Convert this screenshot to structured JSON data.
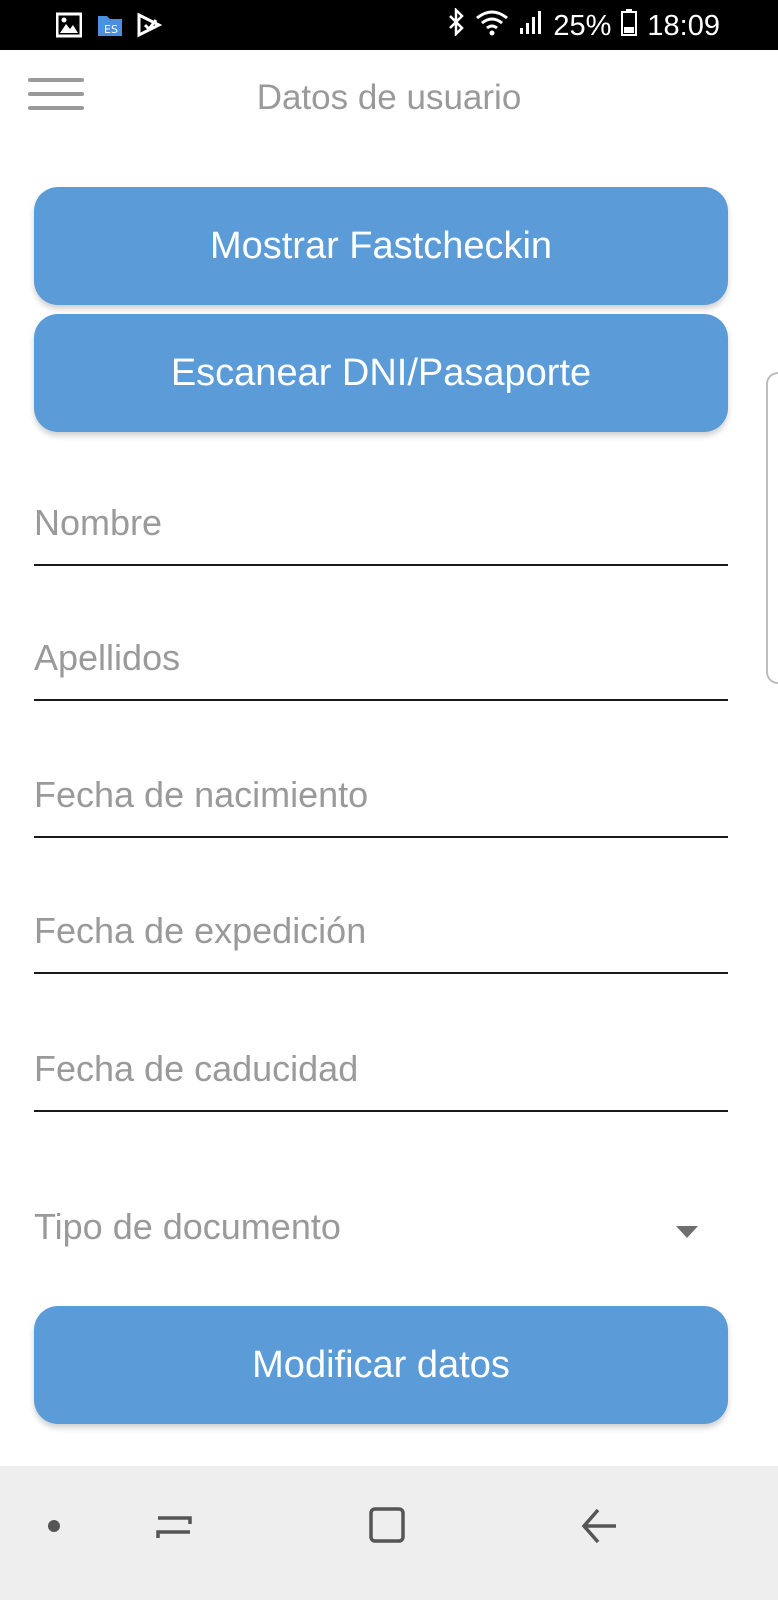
{
  "status_bar": {
    "battery": "25%",
    "time": "18:09",
    "icons": [
      "gallery-icon",
      "file-manager-icon",
      "play-store-icon",
      "bluetooth-icon",
      "wifi-icon",
      "signal-icon",
      "battery-icon"
    ]
  },
  "app_bar": {
    "title": "Datos de usuario",
    "menu_icon": "hamburger-menu-icon"
  },
  "buttons": {
    "show_fastcheckin": "Mostrar Fastcheckin",
    "scan_document": "Escanear DNI/Pasaporte",
    "modify_data": "Modificar datos"
  },
  "form": {
    "fields": [
      {
        "label": "Nombre",
        "value": ""
      },
      {
        "label": "Apellidos",
        "value": ""
      },
      {
        "label": "Fecha de nacimiento",
        "value": ""
      },
      {
        "label": "Fecha de expedición",
        "value": ""
      },
      {
        "label": "Fecha de caducidad",
        "value": ""
      }
    ],
    "document_type": {
      "label": "Tipo de documento",
      "selected": ""
    }
  },
  "colors": {
    "accent": "#5a9bd8",
    "label_gray": "#9a9a9a",
    "status_bar": "#000000",
    "nav_bar": "#eeeeee"
  },
  "nav_bar": {
    "icons": [
      "dot-icon",
      "recents-icon",
      "home-icon",
      "back-icon"
    ]
  }
}
